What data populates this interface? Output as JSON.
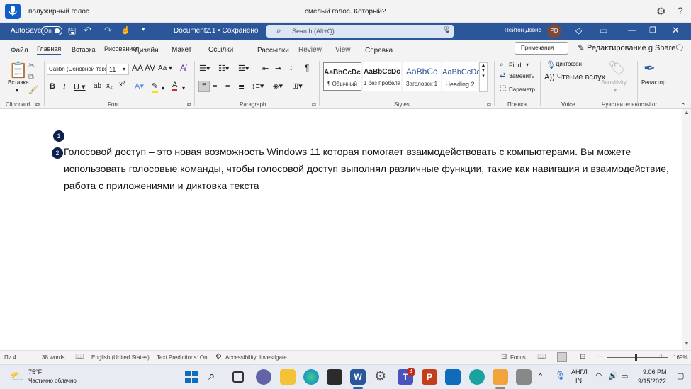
{
  "voice": {
    "status": "полужирный голос",
    "prompt": "смелый голос. Который?"
  },
  "titlebar": {
    "autosave": "AutoSave",
    "autosave_state": "On",
    "doc_title": "Document2.1 • Сохранено",
    "search_placeholder": "Search (Alt+Q)",
    "user_name": "Пейтон Дэвис",
    "avatar_initials": "PD"
  },
  "tabs": [
    "Файл",
    "Главная",
    "Вставка",
    "Рисование",
    "Дизайн",
    "Макет",
    "Ссылки",
    "Рассылки",
    "Review",
    "View",
    "Справка"
  ],
  "tabs_right": {
    "comments": "Примечания",
    "editing": "Редактирование g Share"
  },
  "ribbon": {
    "paste": "Вставка",
    "font_name": "Calibri (Основной текст)",
    "font_size": "11",
    "styles": [
      {
        "preview": "AaBbCcDc",
        "name": "¶ Обычный"
      },
      {
        "preview": "AaBbCcDc",
        "name": "1 без пробела"
      },
      {
        "preview": "AaBbCc",
        "name": "Заголовок 1"
      },
      {
        "preview": "AaBbCcDc",
        "name": "Heading 2"
      }
    ],
    "find": "Find",
    "replace": "Заменить",
    "select": "Параметр",
    "dictate": "Диктофон",
    "read_aloud": "A)) Чтение вслух",
    "sensitivity": "Sensitivity",
    "editor": "Редактор",
    "groups": {
      "clipboard": "Clipboard",
      "font": "Font",
      "paragraph": "Paragraph",
      "styles": "Styles",
      "editing": "Правка",
      "voice": "Voice",
      "sensitivity": "Чувствительность",
      "editor": "itor"
    }
  },
  "document": {
    "badges": [
      "1",
      "2"
    ],
    "text": "Голосовой доступ – это новая возможность Windows 11 которая помогает взаимодействовать с компьютерами. Вы можете использовать голосовые команды, чтобы голосовой доступ выполнял различные функции, такие как навигация и взаимодействие, работа с приложениями и диктовка текста"
  },
  "status": {
    "page": "Пи 4",
    "words": "38 words",
    "language": "English (United States)",
    "predictions": "Text Predictions: On",
    "accessibility": "Accessibility: Investigate",
    "focus": "Focus",
    "zoom": "169%"
  },
  "taskbar": {
    "weather_temp": "75°F",
    "weather_desc": "Частично облачно",
    "lang1": "АНГЛ",
    "lang2": "IN",
    "time": "9:06 PM",
    "date": "9/15/2022",
    "teams_badge": "4"
  }
}
